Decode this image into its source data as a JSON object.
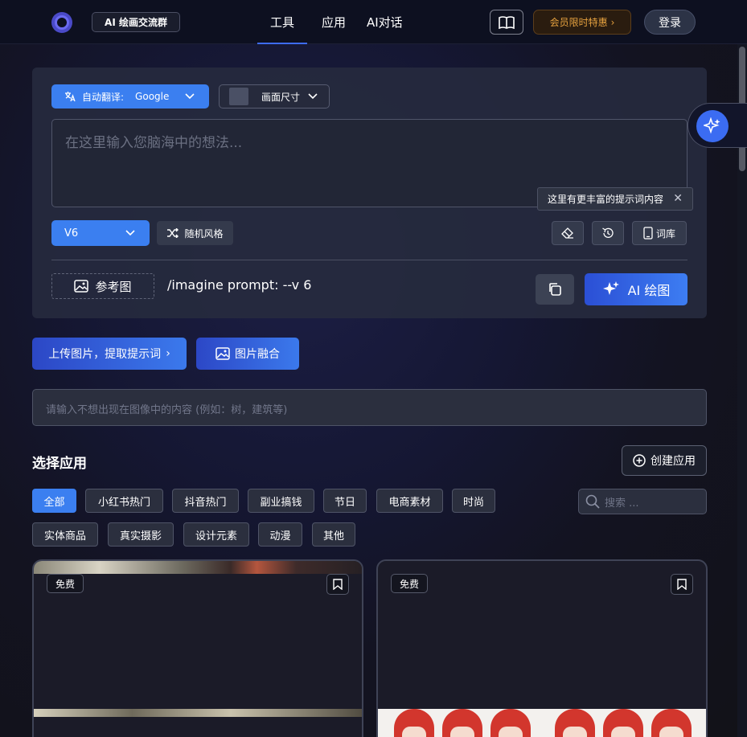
{
  "header": {
    "group_label": "AI 绘画交流群",
    "nav": [
      "工具",
      "应用",
      "AI对话"
    ],
    "vip_label": "会员限时特惠",
    "login_label": "登录"
  },
  "panel": {
    "translate_label": "自动翻译:",
    "translate_value": "Google",
    "size_label": "画面尺寸",
    "prompt_placeholder": "在这里输入您脑海中的想法...",
    "version": "V6",
    "random_label": "随机风格",
    "tooltip": "这里有更丰富的提示词内容",
    "lib_label": "词库",
    "ref_label": "参考图",
    "imagine_text": "/imagine prompt:  --v 6",
    "draw_label": "AI 绘图"
  },
  "actions": {
    "upload_label": "上传图片，提取提示词",
    "fuse_label": "图片融合",
    "negative_placeholder": "请输入不想出现在图像中的内容 (例如：树，建筑等)"
  },
  "apps": {
    "title": "选择应用",
    "create_label": "创建应用",
    "search_placeholder": "搜索 ...",
    "row1": [
      "全部",
      "小红书热门",
      "抖音热门",
      "副业搞钱",
      "节日",
      "电商素材",
      "时尚"
    ],
    "row2": [
      "实体商品",
      "真实摄影",
      "设计元素",
      "动漫",
      "其他"
    ]
  },
  "cards": [
    {
      "badge": "免费"
    },
    {
      "badge": "免费"
    }
  ],
  "colors": {
    "accent": "#3b7ff0",
    "vip": "#e7a23f"
  }
}
